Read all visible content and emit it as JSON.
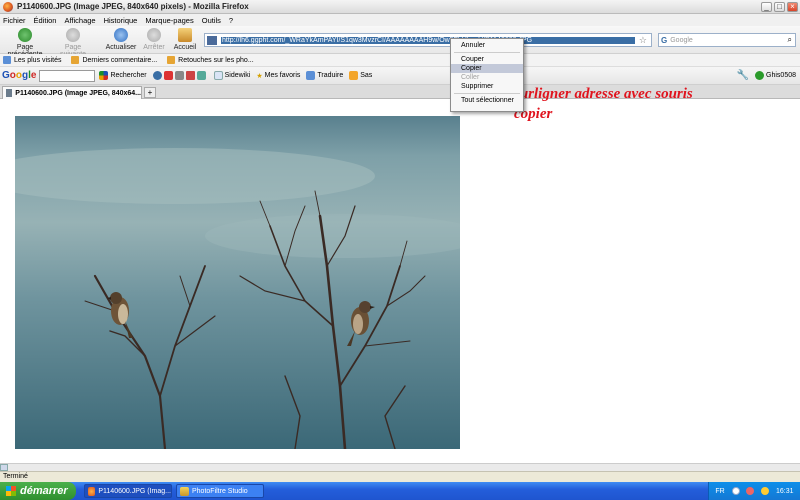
{
  "window": {
    "title": "P1140600.JPG (Image JPEG, 840x640 pixels) - Mozilla Firefox"
  },
  "menu": [
    "Fichier",
    "Édition",
    "Affichage",
    "Historique",
    "Marque-pages",
    "Outils",
    "?"
  ],
  "nav": {
    "back": "Page précédente",
    "forward": "Page suivante",
    "reload": "Actualiser",
    "stop": "Arrêter",
    "home": "Accueil"
  },
  "address": {
    "url": "http://lh6.ggpht.com/_WRaYkAmPAYI/S1qw3MvzrCI/AAAAAAAAH9w/Ow5FbUkapU/P1140600.JPG"
  },
  "search": {
    "engine_letter": "G",
    "placeholder": "Google"
  },
  "bookmarks": [
    {
      "label": "Les plus visités"
    },
    {
      "label": "Derniers commentaire..."
    },
    {
      "label": "Retouches sur les pho..."
    }
  ],
  "google_toolbar": {
    "logo": [
      "G",
      "o",
      "o",
      "g",
      "l",
      "e"
    ],
    "search_button": "Rechercher",
    "sidewiki": "Sidewiki",
    "favorites": "Mes favoris",
    "translate": "Traduire",
    "share": "Sas",
    "account": "Ghis0508"
  },
  "tab": {
    "label": "P1140600.JPG (Image JPEG, 840x64...",
    "new_tab": "+"
  },
  "context_menu": {
    "items": [
      {
        "label": "Annuler",
        "state": "enabled"
      },
      {
        "separator": true
      },
      {
        "label": "Couper",
        "state": "enabled"
      },
      {
        "label": "Copier",
        "state": "highlighted"
      },
      {
        "label": "Coller",
        "state": "disabled"
      },
      {
        "label": "Supprimer",
        "state": "enabled"
      },
      {
        "separator": true
      },
      {
        "label": "Tout sélectionner",
        "state": "enabled"
      }
    ]
  },
  "annotation": {
    "line1": "surligner adresse avec souris",
    "line2": "copier"
  },
  "status": {
    "text": "Terminé"
  },
  "taskbar": {
    "start": "démarrer",
    "tasks": [
      {
        "label": "P1140600.JPG (Imag...",
        "active": true
      },
      {
        "label": "PhotoFiltre Studio",
        "active": false
      }
    ],
    "tray": {
      "lang": "FR",
      "clock": "16:31"
    }
  },
  "colors": {
    "annotation": "#e0141e",
    "taskbar": "#245edb",
    "start": "#2f8f2f"
  }
}
